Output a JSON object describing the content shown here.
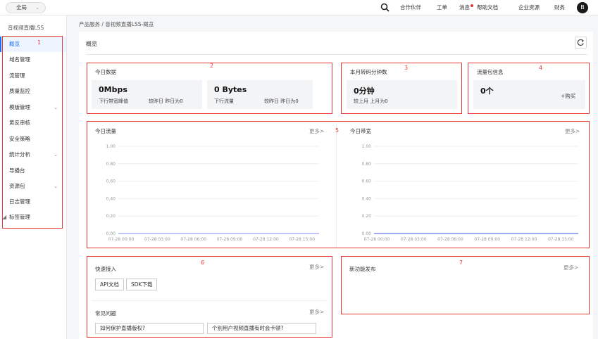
{
  "topbar": {
    "region": "全局",
    "nav": [
      "合作伙伴",
      "工单",
      "消息",
      "帮助文档",
      "企业资源",
      "财务"
    ],
    "avatar_letter": "B"
  },
  "sidebar": {
    "title": "音视频直播LSS",
    "items": [
      {
        "label": "概览",
        "active": true
      },
      {
        "label": "域名管理"
      },
      {
        "label": "流管理"
      },
      {
        "label": "质量监控"
      },
      {
        "label": "模版管理",
        "expandable": true
      },
      {
        "label": "黄反审核"
      },
      {
        "label": "安全策略"
      },
      {
        "label": "统计分析",
        "expandable": true
      },
      {
        "label": "导播台"
      },
      {
        "label": "资源包",
        "expandable": true
      },
      {
        "label": "日志管理"
      },
      {
        "label": "标签管理"
      }
    ]
  },
  "breadcrumb": "产品服务 /  音视频直播LSS-概览",
  "page_title": "概览",
  "today_data": {
    "title": "今日数据",
    "bandwidth": {
      "value": "0Mbps",
      "label": "下行带宽峰值",
      "compare": "较昨日 昨日为0"
    },
    "traffic": {
      "value": "0 Bytes",
      "label": "下行流量",
      "compare": "较昨日 昨日为0"
    }
  },
  "transcode": {
    "title": "本月转码分钟数",
    "value": "0分钟",
    "compare": "较上月 上月为0"
  },
  "package": {
    "title": "流量包信息",
    "value": "0个",
    "buy": "+购买"
  },
  "charts": {
    "traffic": {
      "title": "今日流量",
      "more": "更多>"
    },
    "bandwidth": {
      "title": "今日带宽",
      "more": "更多>"
    }
  },
  "chart_data": [
    {
      "type": "line",
      "title": "今日流量",
      "x": [
        "07-28 00:00",
        "07-28 03:00",
        "07-28 06:00",
        "07-28 09:00",
        "07-28 12:00",
        "07-28 15:00"
      ],
      "yticks": [
        "0.00",
        "0.20",
        "0.40",
        "0.60",
        "0.80",
        "1.00"
      ],
      "ylim": [
        0,
        1
      ],
      "series": [
        {
          "values": [
            0,
            0,
            0,
            0,
            0,
            0
          ]
        }
      ],
      "color": "#9aa3f5"
    },
    {
      "type": "line",
      "title": "今日带宽",
      "x": [
        "07-28 00:00",
        "07-28 03:00",
        "07-28 06:00",
        "07-28 09:00",
        "07-28 12:00",
        "07-28 15:00"
      ],
      "yticks": [
        "0.00",
        "0.20",
        "0.40",
        "0.60",
        "0.80",
        "1.00"
      ],
      "ylim": [
        0,
        1
      ],
      "series": [
        {
          "values": [
            0,
            0,
            0,
            0,
            0,
            0
          ]
        }
      ],
      "color": "#6a78f0"
    }
  ],
  "quick_access": {
    "title": "快速接入",
    "more": "更多>",
    "buttons": [
      "API文档",
      "SDK下载"
    ]
  },
  "faq": {
    "title": "常见问题",
    "more": "更多>",
    "items": [
      "如何保护直播版权?",
      "个别用户视频直播有时会卡顿?"
    ]
  },
  "new_features": {
    "title": "新功能发布",
    "more": "更多>"
  },
  "annotations": [
    "1",
    "2",
    "3",
    "4",
    "5",
    "6",
    "7"
  ],
  "colors": {
    "accent": "#1a6ff2",
    "annotation": "#e53935"
  }
}
